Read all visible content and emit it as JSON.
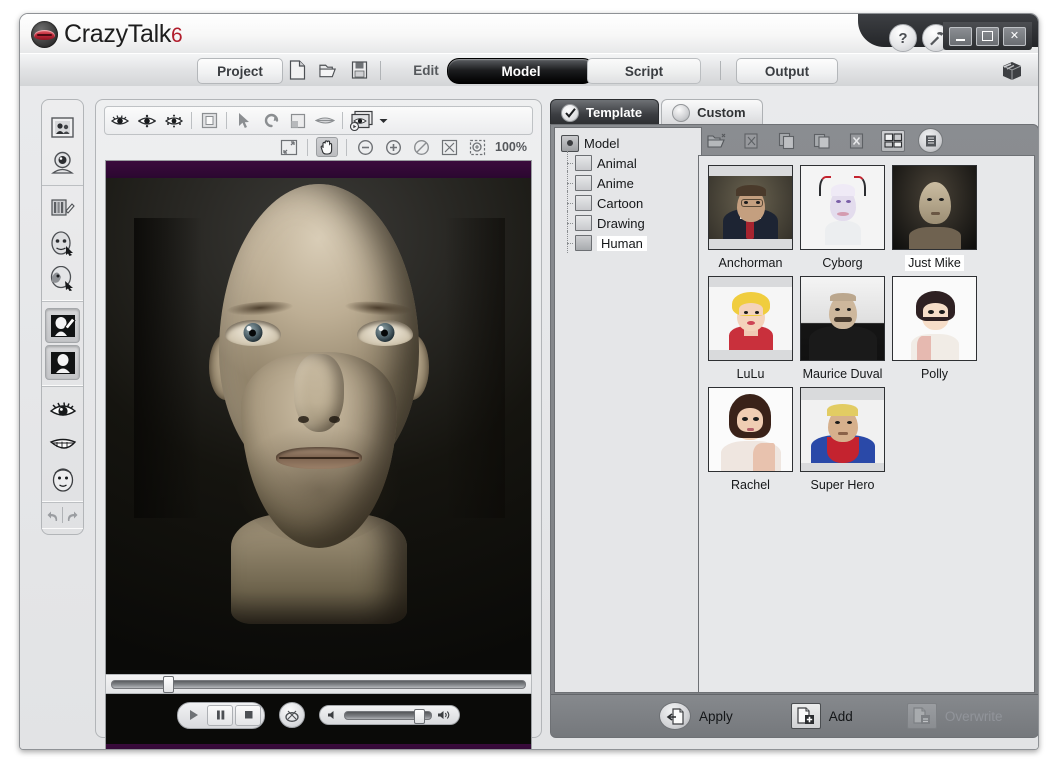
{
  "window": {
    "brand_name": "CrazyTalk",
    "brand_version": "6",
    "help_label": "?",
    "tools_icon": "hammer-icon",
    "minimize_label": "–",
    "maximize_label": "□",
    "close_label": "✕"
  },
  "menubar": {
    "project_label": "Project",
    "file_icons": [
      "new-document-icon",
      "open-folder-icon",
      "save-disk-icon"
    ],
    "tabs": [
      {
        "label": "Edit",
        "active": false
      },
      {
        "label": "Model",
        "active": true
      },
      {
        "label": "Script",
        "active": false
      }
    ],
    "output_label": "Output",
    "cube_icon": "render-cube-icon"
  },
  "left_rail": {
    "groups": [
      {
        "items": [
          {
            "icon": "photo-portrait-icon",
            "selected": false
          },
          {
            "icon": "webcam-icon",
            "selected": false
          }
        ]
      },
      {
        "items": [
          {
            "icon": "sliders-pencil-icon",
            "selected": false
          },
          {
            "icon": "face-fitting-icon",
            "selected": false
          },
          {
            "icon": "face-profile-icon",
            "selected": false
          }
        ]
      },
      {
        "items": [
          {
            "icon": "paint-brush-head-icon",
            "selected": true
          },
          {
            "icon": "avatar-silhouette-icon",
            "selected": true
          }
        ]
      },
      {
        "items": [
          {
            "icon": "eye-icon",
            "selected": false
          },
          {
            "icon": "mouth-teeth-icon",
            "selected": false
          },
          {
            "icon": "head-icon",
            "selected": false
          }
        ]
      }
    ],
    "undo_label": "undo-arrow-icon",
    "redo_label": "redo-arrow-icon"
  },
  "preview": {
    "toolbar_top": [
      "eye-view-icon",
      "eye-markers-icon",
      "eye-points-icon",
      "frame-icon",
      "arrow-select-icon",
      "rotate-icon",
      "layer-icon",
      "lips-icon",
      "playback-layers-icon"
    ],
    "toolbar_zoom": [
      "expand-icon",
      "hand-tool-icon",
      "zoom-out-icon",
      "zoom-in-icon",
      "no-zoom-icon",
      "fit-screen-icon",
      "zoom-region-icon"
    ],
    "zoom_level": "100%",
    "active_tool": "hand-tool-icon",
    "timeline_position_percent": 13,
    "transport": {
      "play_label": "play-icon",
      "pause_label": "pause-icon",
      "stop_label": "stop-icon",
      "loop_label": "loop-record-icon",
      "volume_percent": 88,
      "volume_low_icon": "speaker-low-icon",
      "volume_high_icon": "speaker-high-icon"
    }
  },
  "right_panel": {
    "tabs": [
      {
        "label": "Template",
        "icon": "checkmark-icon",
        "active": true
      },
      {
        "label": "Custom",
        "icon": "circle-icon",
        "active": false
      }
    ],
    "toolbar": [
      "open-folder-icon",
      "cut-icon",
      "copy-icon",
      "paste-icon",
      "delete-icon",
      "thumbnail-view-icon",
      "list-view-icon"
    ],
    "active_toolbar_item": "thumbnail-view-icon",
    "tree": {
      "root": {
        "label": "Model",
        "icon": "model-root-icon"
      },
      "children": [
        {
          "label": "Animal",
          "selected": false
        },
        {
          "label": "Anime",
          "selected": false
        },
        {
          "label": "Cartoon",
          "selected": false
        },
        {
          "label": "Drawing",
          "selected": false
        },
        {
          "label": "Human",
          "selected": true
        }
      ]
    },
    "templates": [
      {
        "name": "Anchorman",
        "selected": false
      },
      {
        "name": "Cyborg",
        "selected": false
      },
      {
        "name": "Just Mike",
        "selected": true
      },
      {
        "name": "LuLu",
        "selected": false
      },
      {
        "name": "Maurice Duval",
        "selected": false
      },
      {
        "name": "Polly",
        "selected": false
      },
      {
        "name": "Rachel",
        "selected": false
      },
      {
        "name": "Super Hero",
        "selected": false
      }
    ],
    "footer": {
      "apply_label": "Apply",
      "add_label": "Add",
      "overwrite_label": "Overwrite",
      "overwrite_disabled": true
    }
  },
  "colors": {
    "accent_red": "#b11d2c",
    "panel_dark": "#7d8084",
    "tab_active": "#000000",
    "canvas_band": "#2b0730",
    "selection_white": "#ffffff"
  }
}
